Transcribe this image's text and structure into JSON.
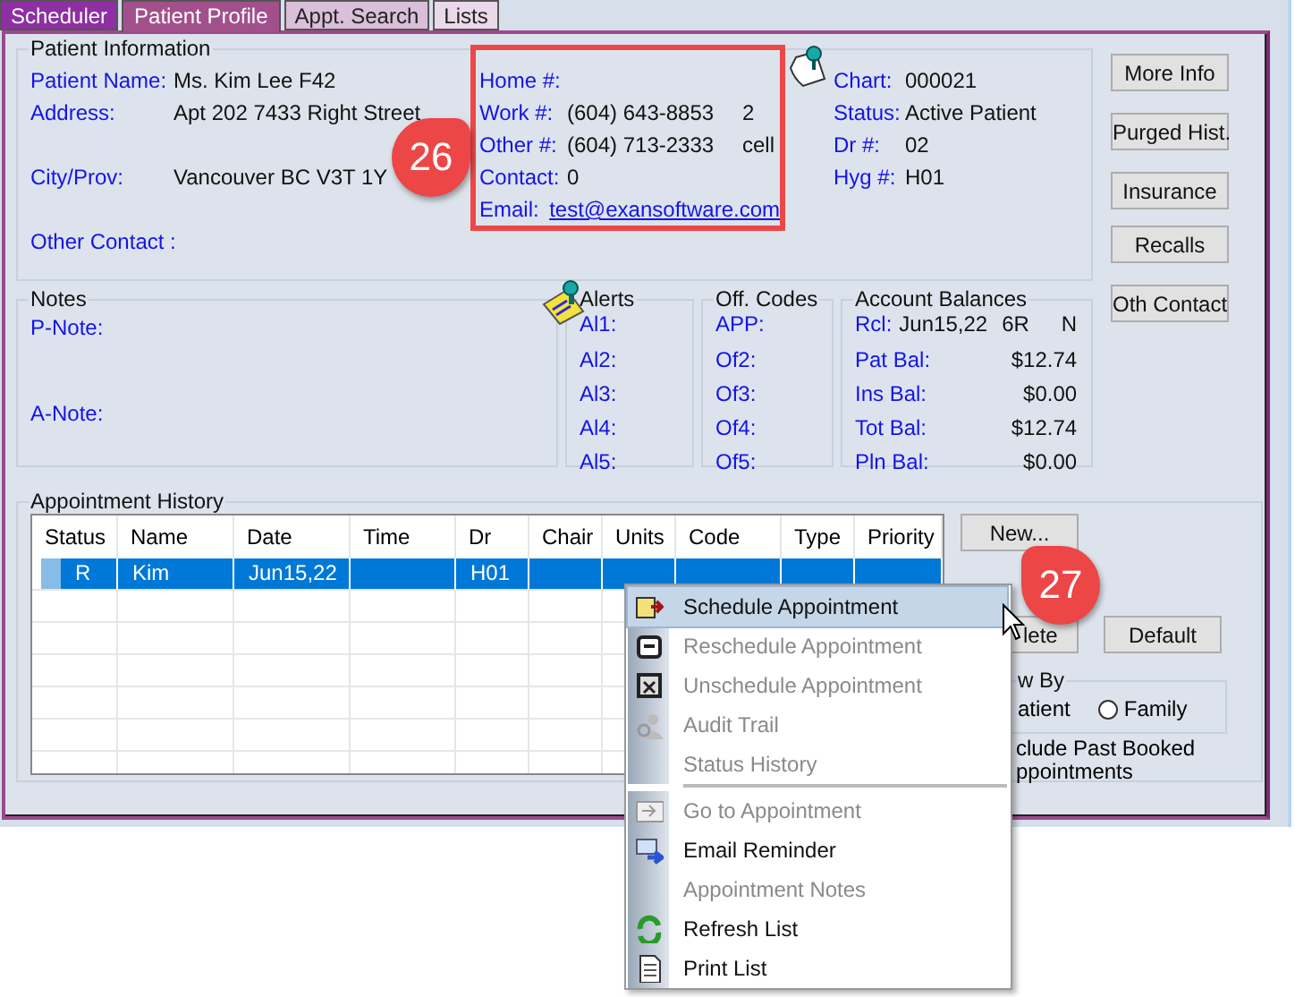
{
  "tabs": [
    {
      "label": "Scheduler",
      "selected": false,
      "color": "#8e2fa3"
    },
    {
      "label": "Patient Profile",
      "selected": true,
      "color": "#a2508c"
    },
    {
      "label": "Appt. Search",
      "selected": false,
      "color": "#d9bfd9"
    },
    {
      "label": "Lists",
      "selected": false,
      "color": "#ead9ea"
    }
  ],
  "patient_info": {
    "title": "Patient Information",
    "fields": [
      {
        "label": "Patient Name:",
        "value": "Ms. Kim Lee F42"
      },
      {
        "label": "Address:",
        "value": "Apt 202 7433 Right Street"
      },
      {
        "label": "City/Prov:",
        "value": "Vancouver BC V3T 1Y"
      },
      {
        "label": "Other Contact :"
      }
    ],
    "contacts": [
      {
        "label": "Home #:"
      },
      {
        "label": "Work #:",
        "value": "(604) 643-8853",
        "extension": "2"
      },
      {
        "label": "Other #:",
        "value": "(604) 713-2333",
        "extension": "cell"
      },
      {
        "label": "Contact:",
        "value": "0"
      },
      {
        "label": "Email:",
        "value": "test@exansoftware.com",
        "kind": "link"
      }
    ],
    "chart": [
      {
        "label": "Chart:",
        "value": "000021"
      },
      {
        "label": "Status:",
        "value": "Active Patient"
      },
      {
        "label": "Dr #:",
        "value": "02"
      },
      {
        "label": "Hyg #:",
        "value": "H01"
      }
    ]
  },
  "side_buttons": [
    "More Info",
    "Purged Hist.",
    "Insurance",
    "Recalls",
    "Oth Contact"
  ],
  "notes": {
    "title": "Notes",
    "fields": [
      "P-Note:",
      "A-Note:"
    ]
  },
  "alerts": {
    "title": "Alerts",
    "labels": [
      "Al1:",
      "Al2:",
      "Al3:",
      "Al4:",
      "Al5:"
    ]
  },
  "off_codes": {
    "title": "Off. Codes",
    "labels": [
      "APP:",
      "Of2:",
      "Of3:",
      "Of4:",
      "Of5:"
    ]
  },
  "account_balances": {
    "title": "Account Balances",
    "recall": {
      "label": "Rcl:",
      "date": "Jun15,22",
      "interval": "6R",
      "flag": "N"
    },
    "rows": [
      {
        "label": "Pat Bal:",
        "value": "$12.74"
      },
      {
        "label": "Ins Bal:",
        "value": "$0.00"
      },
      {
        "label": "Tot Bal:",
        "value": "$12.74"
      },
      {
        "label": "Pln Bal:",
        "value": "$0.00"
      }
    ]
  },
  "appointment_history": {
    "title": "Appointment History",
    "columns": [
      "Status",
      "Name",
      "Date",
      "Time",
      "Dr",
      "Chair",
      "Units",
      "Code",
      "Type",
      "Priority"
    ],
    "rows": [
      {
        "selected": true,
        "status": "R",
        "name": "Kim",
        "date": "Jun15,22",
        "dr": "H01"
      }
    ],
    "buttons": [
      "New...",
      "lete",
      "Default"
    ],
    "view_by": {
      "title": "w By",
      "options": [
        {
          "label": "atient",
          "kind": "text"
        },
        {
          "label": "Family",
          "kind": "radio",
          "selected": false
        }
      ]
    },
    "include_past": [
      "clude Past Booked",
      "ppointments"
    ]
  },
  "context_menu": [
    {
      "label": "Schedule Appointment",
      "disabled": false,
      "selected": true
    },
    {
      "label": "Reschedule Appointment",
      "disabled": true,
      "selected": false
    },
    {
      "label": "Unschedule Appointment",
      "disabled": true,
      "selected": false
    },
    {
      "label": "Audit Trail",
      "disabled": true,
      "selected": false
    },
    {
      "label": "Status History",
      "disabled": true,
      "selected": false
    },
    {
      "kind": "separator"
    },
    {
      "label": "Go to Appointment",
      "disabled": true,
      "selected": false
    },
    {
      "label": "Email Reminder",
      "disabled": false,
      "selected": false
    },
    {
      "label": "Appointment Notes",
      "disabled": true,
      "selected": false
    },
    {
      "label": "Refresh List",
      "disabled": false,
      "selected": false
    },
    {
      "label": "Print List",
      "disabled": false,
      "selected": false
    }
  ],
  "callouts": [
    "26",
    "27"
  ]
}
